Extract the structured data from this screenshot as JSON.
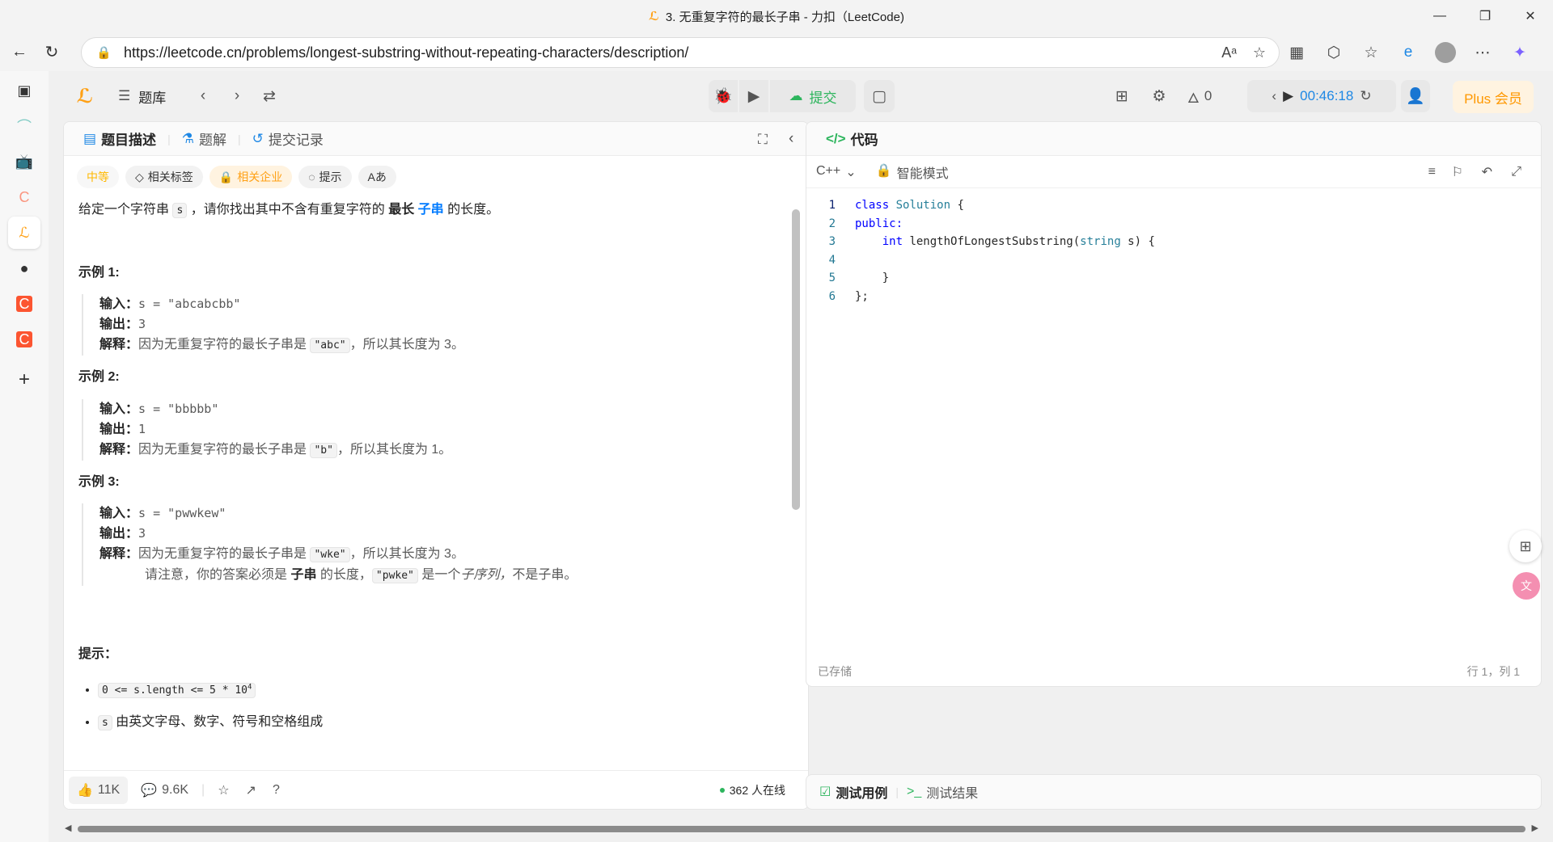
{
  "browser": {
    "tab_title": "3. 无重复字符的最长子串 - 力扣（LeetCode)",
    "url": "https://leetcode.cn/problems/longest-substring-without-repeating-characters/description/"
  },
  "topbar": {
    "problem_list": "题库",
    "submit": "提交",
    "streak": "0",
    "timer": "00:46:18",
    "plus": "Plus 会员"
  },
  "left_panel": {
    "tabs": [
      "题目描述",
      "题解",
      "提交记录"
    ],
    "tags": {
      "difficulty": "中等",
      "topics": "相关标签",
      "companies": "相关企业",
      "hint": "提示",
      "translate": "Aあ"
    },
    "statement": {
      "p1": "给定一个字符串 ",
      "s": "s",
      "p2": " ，请你找出其中不含有重复字符的 ",
      "longest": "最长",
      "substring": "子串",
      "p3": " 的长度。"
    },
    "examples": [
      {
        "title": "示例 1:",
        "input_label": "输入：",
        "input": "s = \"abcabcbb\"",
        "output_label": "输出：",
        "output": "3",
        "explain_label": "解释：",
        "explain_pre": "因为无重复字符的最长子串是 ",
        "explain_code": "\"abc\"",
        "explain_post": "，所以其长度为 3。"
      },
      {
        "title": "示例 2:",
        "input_label": "输入：",
        "input": "s = \"bbbbb\"",
        "output_label": "输出：",
        "output": "1",
        "explain_label": "解释：",
        "explain_pre": "因为无重复字符的最长子串是 ",
        "explain_code": "\"b\"",
        "explain_post": "，所以其长度为 1。"
      },
      {
        "title": "示例 3:",
        "input_label": "输入：",
        "input": "s = \"pwwkew\"",
        "output_label": "输出：",
        "output": "3",
        "explain_label": "解释：",
        "explain_pre": "因为无重复字符的最长子串是 ",
        "explain_code": "\"wke\"",
        "explain_post": "，所以其长度为 3。",
        "note_pre": "请注意，你的答案必须是 ",
        "note_bold": "子串",
        "note_mid": " 的长度，",
        "note_code": "\"pwke\"",
        "note_mid2": " 是一个",
        "note_italic": "子序列，",
        "note_post": "不是子串。"
      }
    ],
    "hints_title": "提示：",
    "constraints": {
      "c1": "0 <= s.length <= 5 * 10",
      "c1_sup": "4",
      "c2_code": "s",
      "c2_text": " 由英文字母、数字、符号和空格组成"
    },
    "footer": {
      "likes": "11K",
      "comments": "9.6K",
      "online": "362 人在线"
    }
  },
  "code_panel": {
    "title": "代码",
    "language": "C++",
    "mode": "智能模式",
    "saved": "已存储",
    "cursor": "行 1，列 1",
    "lines": [
      {
        "n": "1",
        "text": "class Solution {"
      },
      {
        "n": "2",
        "text": "public:"
      },
      {
        "n": "3",
        "text": "    int lengthOfLongestSubstring(string s) {"
      },
      {
        "n": "4",
        "text": ""
      },
      {
        "n": "5",
        "text": "    }"
      },
      {
        "n": "6",
        "text": "};"
      }
    ]
  },
  "test_panel": {
    "tab1": "测试用例",
    "tab2": "测试结果"
  }
}
